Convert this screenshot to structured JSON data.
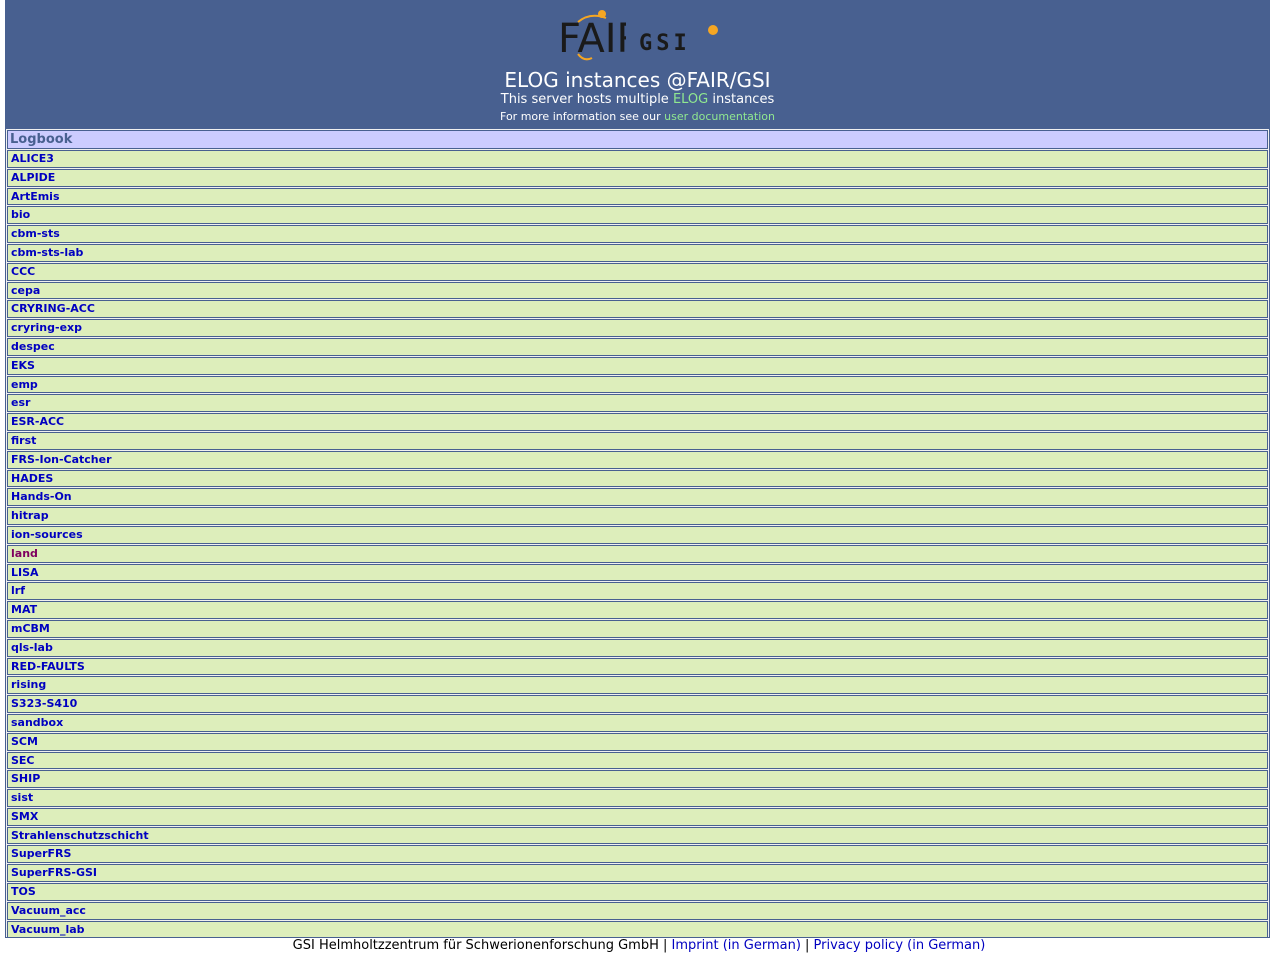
{
  "header": {
    "title": "ELOG instances @FAIR/GSI",
    "subtitle_pre": "This server hosts multiple ",
    "subtitle_link": "ELOG",
    "subtitle_post": " instances",
    "info_pre": "For more information see our ",
    "info_link": "user documentation",
    "fair_logo_text": "FAIR",
    "gsi_logo_text": "GSI"
  },
  "table": {
    "column_header": "Logbook",
    "logbooks": [
      "ALICE3",
      "ALPIDE",
      "ArtEmis",
      "bio",
      "cbm-sts",
      "cbm-sts-lab",
      "CCC",
      "cepa",
      "CRYRING-ACC",
      "cryring-exp",
      "despec",
      "EKS",
      "emp",
      "esr",
      "ESR-ACC",
      "first",
      "FRS-Ion-Catcher",
      "HADES",
      "Hands-On",
      "hitrap",
      "ion-sources",
      "land",
      "LISA",
      "lrf",
      "MAT",
      "mCBM",
      "qls-lab",
      "RED-FAULTS",
      "rising",
      "S323-S410",
      "sandbox",
      "SCM",
      "SEC",
      "SHIP",
      "sist",
      "SMX",
      "Strahlenschutzschicht",
      "SuperFRS",
      "SuperFRS-GSI",
      "TOS",
      "Vacuum_acc",
      "Vacuum_lab"
    ],
    "visited": [
      "land"
    ]
  },
  "footer": {
    "org": "GSI Helmholtzzentrum für Schwerionenforschung GmbH",
    "sep1": " | ",
    "imprint": "Imprint (in German)",
    "sep2": " | ",
    "privacy": "Privacy policy (in German)"
  },
  "colors": {
    "header_bg": "#486090",
    "row_bg": "#ddeebb",
    "column_header_bg": "#ccccff",
    "link": "#0000c0",
    "visited_link": "#800060",
    "accent_green": "#90e890",
    "logo_orange": "#f5a623"
  }
}
